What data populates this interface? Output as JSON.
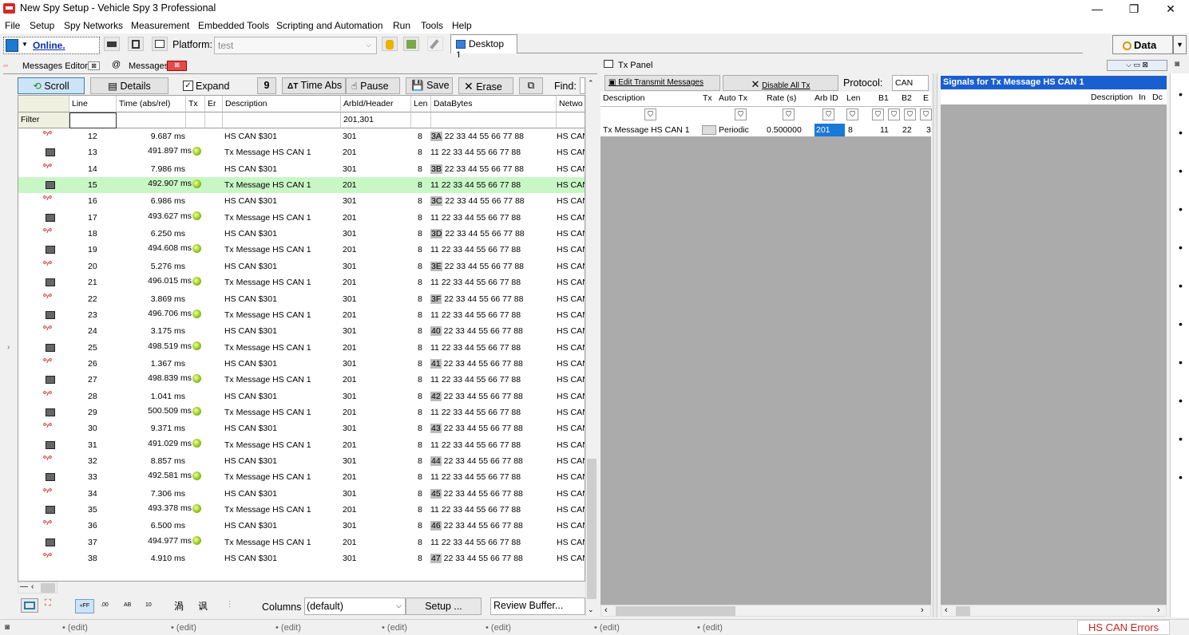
{
  "window": {
    "title": "New Spy Setup - Vehicle Spy 3 Professional",
    "minimize": "—",
    "maximize": "❐",
    "close": "✕"
  },
  "menu": [
    "File",
    "Setup",
    "Spy Networks",
    "Measurement",
    "Embedded Tools",
    "Scripting and Automation",
    "Run",
    "Tools",
    "Help"
  ],
  "toolbar": {
    "online": "Online.",
    "platform_label": "Platform:",
    "platform_value": "test",
    "desktop_tab": "Desktop 1",
    "data_button": "Data"
  },
  "left_tabs": {
    "messages_editor": "Messages Editor",
    "messages": "Messages"
  },
  "msg_toolbar": {
    "scroll": "Scroll",
    "details": "Details",
    "expand": "Expand",
    "time_abs": "Time Abs",
    "pause": "Pause",
    "save": "Save",
    "erase": "Erase",
    "find": "Find:"
  },
  "grid": {
    "headers": [
      "Line",
      "Time (abs/rel)",
      "Tx",
      "Er",
      "Description",
      "ArbId/Header",
      "Len",
      "DataBytes",
      "Netwo"
    ],
    "filter_label": "Filter",
    "filter_arbid": "201,301",
    "rows": [
      {
        "line": "12",
        "time": "9.687 ms",
        "dot": false,
        "desc": "HS CAN $301",
        "arb": "301",
        "len": "8",
        "b0": "3A",
        "rest": "22 33 44 55 66 77 88",
        "net": "HS CAN",
        "type": "rx"
      },
      {
        "line": "13",
        "time": "491.897 ms",
        "dot": true,
        "desc": "Tx Message HS CAN 1",
        "arb": "201",
        "len": "8",
        "b0": "",
        "rest": "11 22 33 44 55 66 77 88",
        "net": "HS CAN",
        "type": "tx"
      },
      {
        "line": "14",
        "time": "7.986 ms",
        "dot": false,
        "desc": "HS CAN $301",
        "arb": "301",
        "len": "8",
        "b0": "3B",
        "rest": "22 33 44 55 66 77 88",
        "net": "HS CAN",
        "type": "rx"
      },
      {
        "line": "15",
        "time": "492.907 ms",
        "dot": true,
        "desc": "Tx Message HS CAN 1",
        "arb": "201",
        "len": "8",
        "b0": "",
        "rest": "11 22 33 44 55 66 77 88",
        "net": "HS CAN",
        "type": "tx",
        "selected": true
      },
      {
        "line": "16",
        "time": "6.986 ms",
        "dot": false,
        "desc": "HS CAN $301",
        "arb": "301",
        "len": "8",
        "b0": "3C",
        "rest": "22 33 44 55 66 77 88",
        "net": "HS CAN",
        "type": "rx"
      },
      {
        "line": "17",
        "time": "493.627 ms",
        "dot": true,
        "desc": "Tx Message HS CAN 1",
        "arb": "201",
        "len": "8",
        "b0": "",
        "rest": "11 22 33 44 55 66 77 88",
        "net": "HS CAN",
        "type": "tx"
      },
      {
        "line": "18",
        "time": "6.250 ms",
        "dot": false,
        "desc": "HS CAN $301",
        "arb": "301",
        "len": "8",
        "b0": "3D",
        "rest": "22 33 44 55 66 77 88",
        "net": "HS CAN",
        "type": "rx"
      },
      {
        "line": "19",
        "time": "494.608 ms",
        "dot": true,
        "desc": "Tx Message HS CAN 1",
        "arb": "201",
        "len": "8",
        "b0": "",
        "rest": "11 22 33 44 55 66 77 88",
        "net": "HS CAN",
        "type": "tx"
      },
      {
        "line": "20",
        "time": "5.276 ms",
        "dot": false,
        "desc": "HS CAN $301",
        "arb": "301",
        "len": "8",
        "b0": "3E",
        "rest": "22 33 44 55 66 77 88",
        "net": "HS CAN",
        "type": "rx"
      },
      {
        "line": "21",
        "time": "496.015 ms",
        "dot": true,
        "desc": "Tx Message HS CAN 1",
        "arb": "201",
        "len": "8",
        "b0": "",
        "rest": "11 22 33 44 55 66 77 88",
        "net": "HS CAN",
        "type": "tx"
      },
      {
        "line": "22",
        "time": "3.869 ms",
        "dot": false,
        "desc": "HS CAN $301",
        "arb": "301",
        "len": "8",
        "b0": "3F",
        "rest": "22 33 44 55 66 77 88",
        "net": "HS CAN",
        "type": "rx"
      },
      {
        "line": "23",
        "time": "496.706 ms",
        "dot": true,
        "desc": "Tx Message HS CAN 1",
        "arb": "201",
        "len": "8",
        "b0": "",
        "rest": "11 22 33 44 55 66 77 88",
        "net": "HS CAN",
        "type": "tx"
      },
      {
        "line": "24",
        "time": "3.175 ms",
        "dot": false,
        "desc": "HS CAN $301",
        "arb": "301",
        "len": "8",
        "b0": "40",
        "rest": "22 33 44 55 66 77 88",
        "net": "HS CAN",
        "type": "rx"
      },
      {
        "line": "25",
        "time": "498.519 ms",
        "dot": true,
        "desc": "Tx Message HS CAN 1",
        "arb": "201",
        "len": "8",
        "b0": "",
        "rest": "11 22 33 44 55 66 77 88",
        "net": "HS CAN",
        "type": "tx"
      },
      {
        "line": "26",
        "time": "1.367 ms",
        "dot": false,
        "desc": "HS CAN $301",
        "arb": "301",
        "len": "8",
        "b0": "41",
        "rest": "22 33 44 55 66 77 88",
        "net": "HS CAN",
        "type": "rx"
      },
      {
        "line": "27",
        "time": "498.839 ms",
        "dot": true,
        "desc": "Tx Message HS CAN 1",
        "arb": "201",
        "len": "8",
        "b0": "",
        "rest": "11 22 33 44 55 66 77 88",
        "net": "HS CAN",
        "type": "tx"
      },
      {
        "line": "28",
        "time": "1.041 ms",
        "dot": false,
        "desc": "HS CAN $301",
        "arb": "301",
        "len": "8",
        "b0": "42",
        "rest": "22 33 44 55 66 77 88",
        "net": "HS CAN",
        "type": "rx"
      },
      {
        "line": "29",
        "time": "500.509 ms",
        "dot": true,
        "desc": "Tx Message HS CAN 1",
        "arb": "201",
        "len": "8",
        "b0": "",
        "rest": "11 22 33 44 55 66 77 88",
        "net": "HS CAN",
        "type": "tx"
      },
      {
        "line": "30",
        "time": "9.371 ms",
        "dot": false,
        "desc": "HS CAN $301",
        "arb": "301",
        "len": "8",
        "b0": "43",
        "rest": "22 33 44 55 66 77 88",
        "net": "HS CAN",
        "type": "rx"
      },
      {
        "line": "31",
        "time": "491.029 ms",
        "dot": true,
        "desc": "Tx Message HS CAN 1",
        "arb": "201",
        "len": "8",
        "b0": "",
        "rest": "11 22 33 44 55 66 77 88",
        "net": "HS CAN",
        "type": "tx"
      },
      {
        "line": "32",
        "time": "8.857 ms",
        "dot": false,
        "desc": "HS CAN $301",
        "arb": "301",
        "len": "8",
        "b0": "44",
        "rest": "22 33 44 55 66 77 88",
        "net": "HS CAN",
        "type": "rx"
      },
      {
        "line": "33",
        "time": "492.581 ms",
        "dot": true,
        "desc": "Tx Message HS CAN 1",
        "arb": "201",
        "len": "8",
        "b0": "",
        "rest": "11 22 33 44 55 66 77 88",
        "net": "HS CAN",
        "type": "tx"
      },
      {
        "line": "34",
        "time": "7.306 ms",
        "dot": false,
        "desc": "HS CAN $301",
        "arb": "301",
        "len": "8",
        "b0": "45",
        "rest": "22 33 44 55 66 77 88",
        "net": "HS CAN",
        "type": "rx"
      },
      {
        "line": "35",
        "time": "493.378 ms",
        "dot": true,
        "desc": "Tx Message HS CAN 1",
        "arb": "201",
        "len": "8",
        "b0": "",
        "rest": "11 22 33 44 55 66 77 88",
        "net": "HS CAN",
        "type": "tx"
      },
      {
        "line": "36",
        "time": "6.500 ms",
        "dot": false,
        "desc": "HS CAN $301",
        "arb": "301",
        "len": "8",
        "b0": "46",
        "rest": "22 33 44 55 66 77 88",
        "net": "HS CAN",
        "type": "rx"
      },
      {
        "line": "37",
        "time": "494.977 ms",
        "dot": true,
        "desc": "Tx Message HS CAN 1",
        "arb": "201",
        "len": "8",
        "b0": "",
        "rest": "11 22 33 44 55 66 77 88",
        "net": "HS CAN",
        "type": "tx"
      },
      {
        "line": "38",
        "time": "4.910 ms",
        "dot": false,
        "desc": "HS CAN $301",
        "arb": "301",
        "len": "8",
        "b0": "47",
        "rest": "22 33 44 55 66 77 88",
        "net": "HS CAN",
        "type": "rx"
      }
    ]
  },
  "msg_bottom": {
    "columns_label": "Columns",
    "columns_value": "(default)",
    "setup": "Setup ...",
    "review": "Review Buffer..."
  },
  "status": {
    "edits": [
      "• (edit)",
      "• (edit)",
      "• (edit)",
      "• (edit)",
      "• (edit)",
      "• (edit)",
      "• (edit)"
    ],
    "hs_can_errors": "HS CAN Errors"
  },
  "tx_panel": {
    "title": "Tx Panel",
    "edit_button": "Edit Transmit Messages",
    "disable_button": "Disable All Tx",
    "protocol_label": "Protocol:",
    "protocol_value": "CAN",
    "headers": [
      "Description",
      "Tx",
      "Auto Tx",
      "Rate (s)",
      "Arb ID",
      "Len",
      "B1",
      "B2",
      "E"
    ],
    "row": {
      "desc": "Tx Message HS CAN 1",
      "auto": "Periodic",
      "rate": "0.500000",
      "arb": "201",
      "len": "8",
      "b1": "11",
      "b2": "22",
      "b3": "3"
    }
  },
  "signals_panel": {
    "title": "Signals for Tx Message HS CAN 1",
    "headers": [
      "Description",
      "In",
      "Dc"
    ]
  },
  "colors": {
    "selected_row": "#c8f7c5",
    "signals_title": "#1a5fd0",
    "tx_area": "#ababab",
    "errors_text": "#d02020"
  }
}
